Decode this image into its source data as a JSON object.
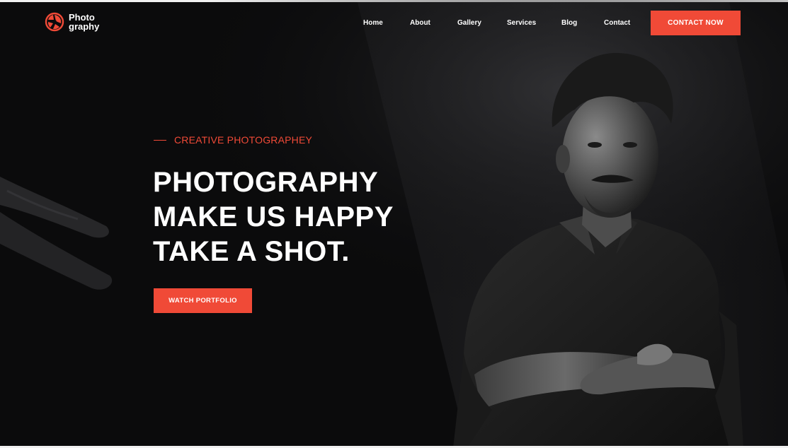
{
  "brand": {
    "name_line1": "Photo",
    "name_line2": "graphy",
    "logo_icon": "aperture-swirl-icon",
    "accent_color": "#f04a37"
  },
  "nav": {
    "items": [
      {
        "label": "Home"
      },
      {
        "label": "About"
      },
      {
        "label": "Gallery"
      },
      {
        "label": "Services"
      },
      {
        "label": "Blog"
      },
      {
        "label": "Contact"
      }
    ],
    "cta_label": "CONTACT NOW"
  },
  "hero": {
    "eyebrow": "CREATIVE PHOTOGRAPHEY",
    "headline_lines": [
      "PHOTOGRAPHY",
      "MAKE US HAPPY",
      "TAKE A SHOT."
    ],
    "cta_label": "WATCH PORTFOLIO",
    "image": "portrait-man-crossed-arms"
  },
  "colors": {
    "background": "#0b0b0c",
    "text": "#ffffff",
    "accent": "#f04a37"
  }
}
